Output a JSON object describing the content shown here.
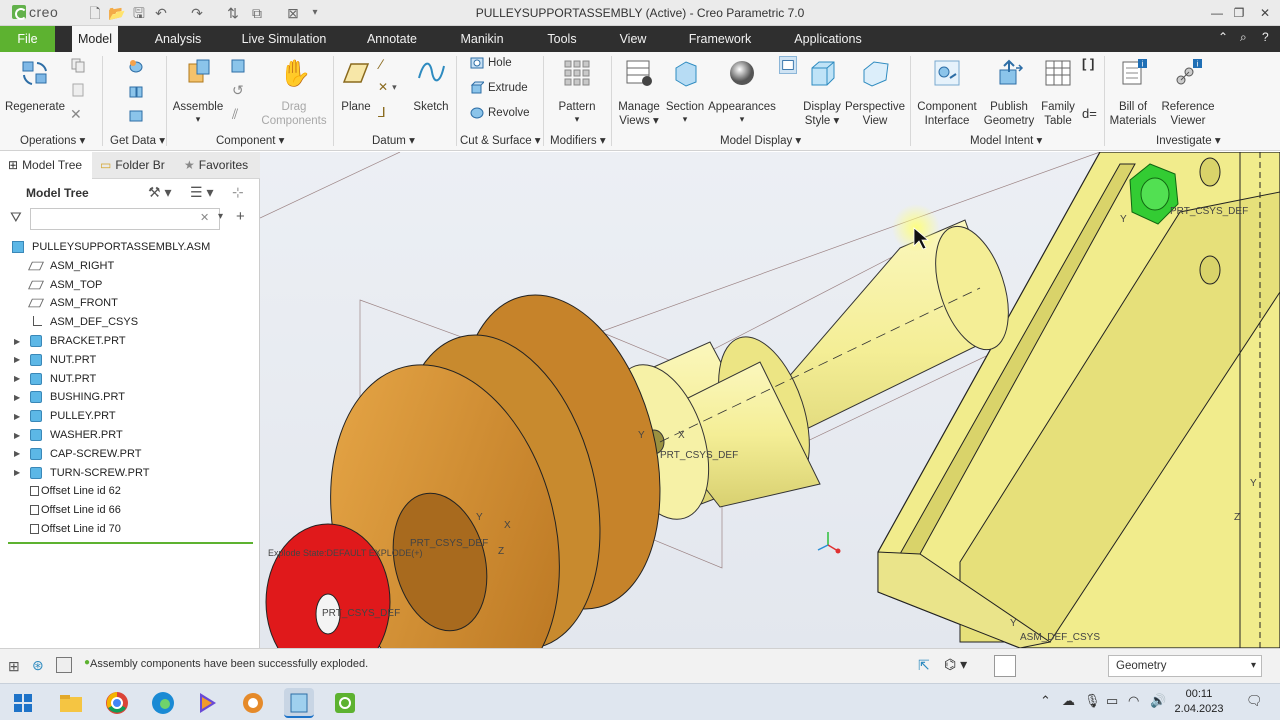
{
  "app": {
    "title": "PULLEYSUPPORTASSEMBLY (Active) - Creo Parametric 7.0",
    "logo_text": "creo",
    "accent_color": "#5db230"
  },
  "menubar": {
    "tabs": [
      "File",
      "Model",
      "Analysis",
      "Live Simulation",
      "Annotate",
      "Manikin",
      "Tools",
      "View",
      "Framework",
      "Applications"
    ],
    "active": "Model"
  },
  "ribbon": {
    "operations": {
      "regenerate": "Regenerate",
      "group": "Operations"
    },
    "getdata": {
      "group": "Get Data"
    },
    "component": {
      "assemble": "Assemble",
      "drag1": "Drag",
      "drag2": "Components",
      "group": "Component"
    },
    "datum": {
      "plane": "Plane",
      "sketch": "Sketch",
      "group": "Datum"
    },
    "cutsurface": {
      "hole": "Hole",
      "extrude": "Extrude",
      "revolve": "Revolve",
      "group": "Cut & Surface"
    },
    "modifiers": {
      "pattern": "Pattern",
      "group": "Modifiers"
    },
    "modeldisplay": {
      "manage1": "Manage",
      "manage2": "Views",
      "section": "Section",
      "appearances": "Appearances",
      "display1": "Display",
      "display2": "Style",
      "persp1": "Perspective",
      "persp2": "View",
      "group": "Model Display"
    },
    "modelintent": {
      "comp1": "Component",
      "comp2": "Interface",
      "pub1": "Publish",
      "pub2": "Geometry",
      "fam1": "Family",
      "fam2": "Table",
      "group": "Model Intent"
    },
    "investigate": {
      "bom1": "Bill of",
      "bom2": "Materials",
      "ref1": "Reference",
      "ref2": "Viewer",
      "group": "Investigate"
    }
  },
  "panel": {
    "tabs": [
      "Model Tree",
      "Folder Br",
      "Favorites"
    ],
    "tree_heading": "Model Tree",
    "search_value": "",
    "tree": [
      {
        "label": "PULLEYSUPPORTASSEMBLY.ASM",
        "icon": "assembly-icon"
      },
      {
        "label": "ASM_RIGHT",
        "icon": "datum-plane-icon"
      },
      {
        "label": "ASM_TOP",
        "icon": "datum-plane-icon"
      },
      {
        "label": "ASM_FRONT",
        "icon": "datum-plane-icon"
      },
      {
        "label": "ASM_DEF_CSYS",
        "icon": "csys-icon"
      },
      {
        "label": "BRACKET.PRT",
        "icon": "part-icon"
      },
      {
        "label": "NUT.PRT",
        "icon": "part-icon"
      },
      {
        "label": "NUT.PRT",
        "icon": "part-icon"
      },
      {
        "label": "BUSHING.PRT",
        "icon": "part-icon"
      },
      {
        "label": "PULLEY.PRT",
        "icon": "part-icon"
      },
      {
        "label": "WASHER.PRT",
        "icon": "part-icon"
      },
      {
        "label": "CAP-SCREW.PRT",
        "icon": "part-icon"
      },
      {
        "label": "TURN-SCREW.PRT",
        "icon": "part-icon"
      },
      {
        "label": "Offset Line id 62",
        "icon": "offset-line-icon"
      },
      {
        "label": "Offset Line id 66",
        "icon": "offset-line-icon"
      },
      {
        "label": "Offset Line id 70",
        "icon": "offset-line-icon"
      }
    ]
  },
  "viewport": {
    "labels": {
      "prt_csys": "PRT_CSYS_DEF",
      "asm_csys": "ASM_DEF_CSYS",
      "explode_state": "Explode State:DEFAULT EXPLODE(+)",
      "x": "X",
      "y": "Y",
      "z": "Z"
    },
    "colors": {
      "pulley": "#d6952e",
      "bushing": "#f4ee96",
      "washer": "#e0191b",
      "nut": "#33cc33",
      "bracket": "#f1ec8c"
    }
  },
  "status": {
    "message": "Assembly components have been successfully exploded.",
    "filter": "Geometry"
  },
  "taskbar": {
    "time": "00:11",
    "date": "2.04.2023"
  }
}
